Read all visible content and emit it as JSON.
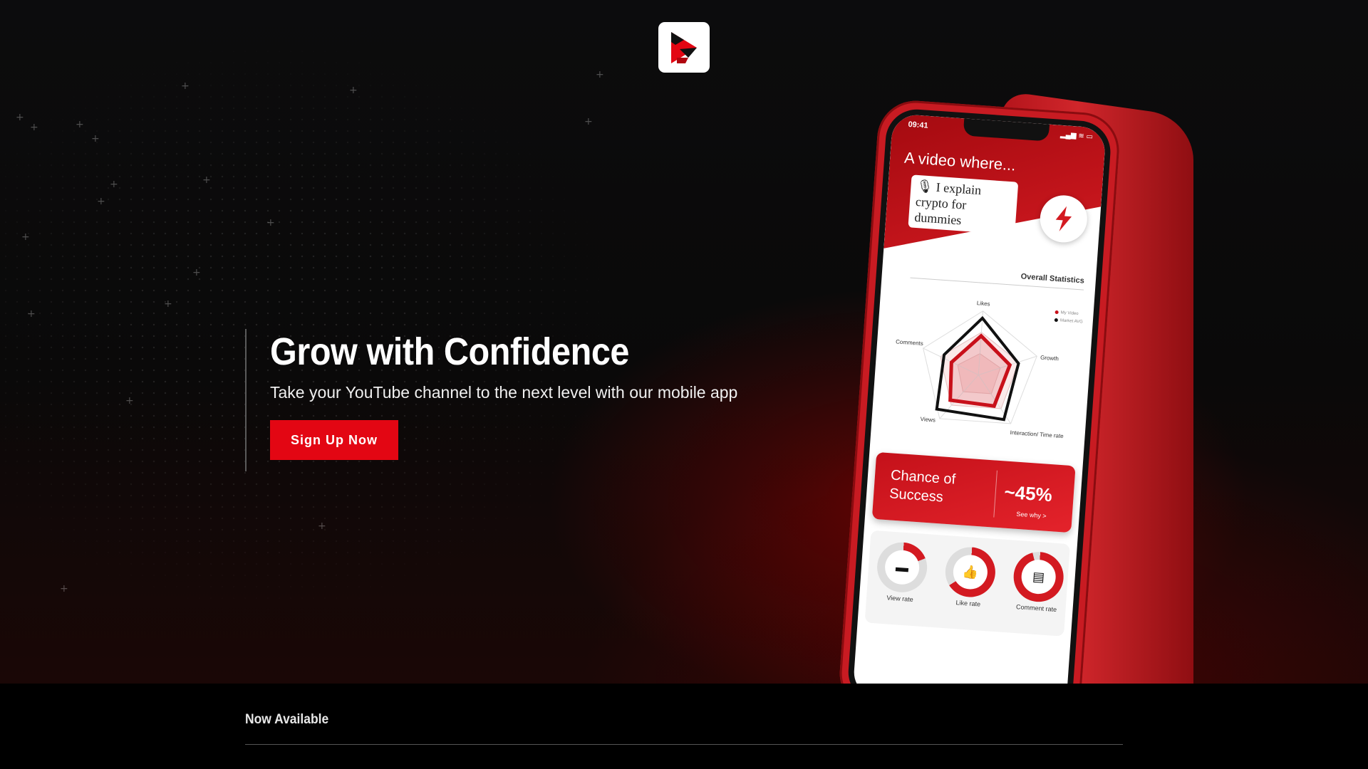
{
  "hero": {
    "headline": "Grow with Confidence",
    "subheadline": "Take your YouTube channel to the next level with our mobile app",
    "cta_label": "Sign Up Now"
  },
  "phone": {
    "status_time": "09:41",
    "screen_title": "A video where...",
    "prompt_text": "I explain crypto for dummies",
    "stats_title": "Overall Statistics",
    "radar_axes": [
      "Likes",
      "Growth",
      "Interaction/ Time rate",
      "Views",
      "Comments"
    ],
    "legend": [
      "My Video",
      "Market AVG"
    ],
    "chance_label": "Chance of Success",
    "chance_value": "~45%",
    "see_why": "See why >",
    "rates": [
      {
        "label": "View rate",
        "icon": "monitor-icon"
      },
      {
        "label": "Like rate",
        "icon": "thumbs-up-icon"
      },
      {
        "label": "Comment rate",
        "icon": "comment-icon"
      }
    ]
  },
  "footer": {
    "now_available": "Now Available"
  },
  "colors": {
    "accent": "#e30613",
    "background": "#0a0909",
    "phone_red": "#c81b22"
  }
}
